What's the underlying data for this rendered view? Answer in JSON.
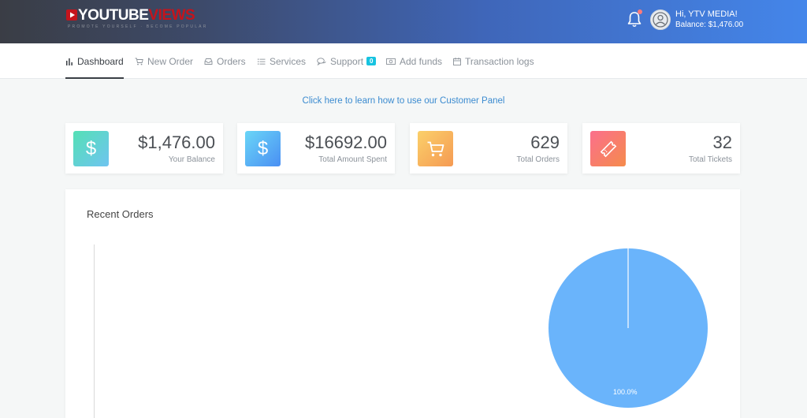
{
  "brand": {
    "logo_white": "YOUTUBE",
    "logo_red": "VIEWS",
    "tagline": "PROMOTE YOURSELF · BECOME POPULAR"
  },
  "user": {
    "greeting": "Hi, YTV MEDIA!",
    "balance": "Balance: $1,476.00"
  },
  "nav": {
    "dashboard": "Dashboard",
    "new_order": "New Order",
    "orders": "Orders",
    "services": "Services",
    "support": "Support",
    "support_badge": "0",
    "add_funds": "Add funds",
    "transaction_logs": "Transaction logs"
  },
  "help_link": "Click here to learn how to use our Customer Panel",
  "stats": [
    {
      "value": "$1,476.00",
      "label": "Your Balance",
      "icon": "dollar-icon"
    },
    {
      "value": "$16692.00",
      "label": "Total Amount Spent",
      "icon": "dollar-icon"
    },
    {
      "value": "629",
      "label": "Total Orders",
      "icon": "cart-icon"
    },
    {
      "value": "32",
      "label": "Total Tickets",
      "icon": "ticket-icon"
    }
  ],
  "recent_orders": {
    "title": "Recent Orders",
    "pie_label": "100.0%"
  },
  "colors": {
    "accent": "#3b8bd0",
    "pie": "#6ab4fb",
    "badge": "#17c3e0"
  }
}
